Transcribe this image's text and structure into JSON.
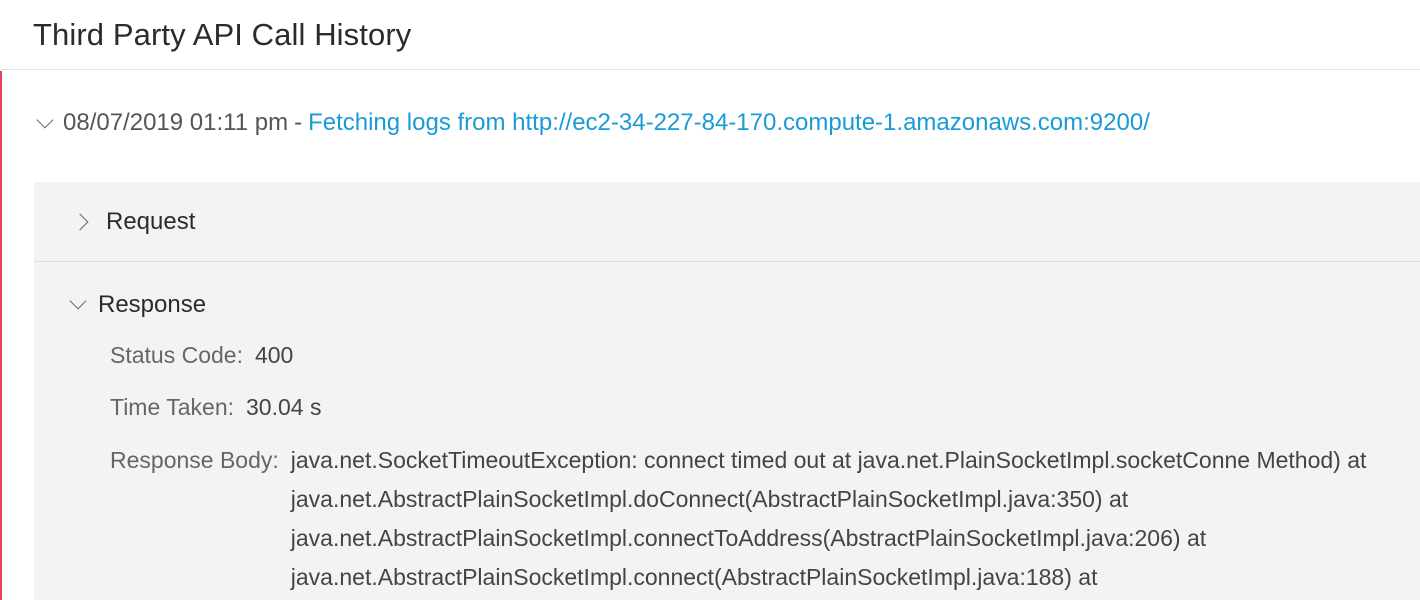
{
  "header": {
    "title": "Third Party API Call History"
  },
  "entry": {
    "timestamp": "08/07/2019 01:11 pm",
    "separator": "-",
    "description": "Fetching logs from http://ec2-34-227-84-170.compute-1.amazonaws.com:9200/"
  },
  "request": {
    "label": "Request",
    "expanded": false
  },
  "response": {
    "label": "Response",
    "expanded": true,
    "status_code_label": "Status Code:",
    "status_code": "400",
    "time_taken_label": "Time Taken:",
    "time_taken": "30.04 s",
    "body_label": "Response Body:",
    "body": "java.net.SocketTimeoutException: connect timed out at java.net.PlainSocketImpl.socketConne Method) at java.net.AbstractPlainSocketImpl.doConnect(AbstractPlainSocketImpl.java:350) at java.net.AbstractPlainSocketImpl.connectToAddress(AbstractPlainSocketImpl.java:206) at java.net.AbstractPlainSocketImpl.connect(AbstractPlainSocketImpl.java:188) at"
  },
  "colors": {
    "accent_border": "#e8435a",
    "link": "#1a9ad6",
    "panel_bg": "#f3f3f3"
  }
}
